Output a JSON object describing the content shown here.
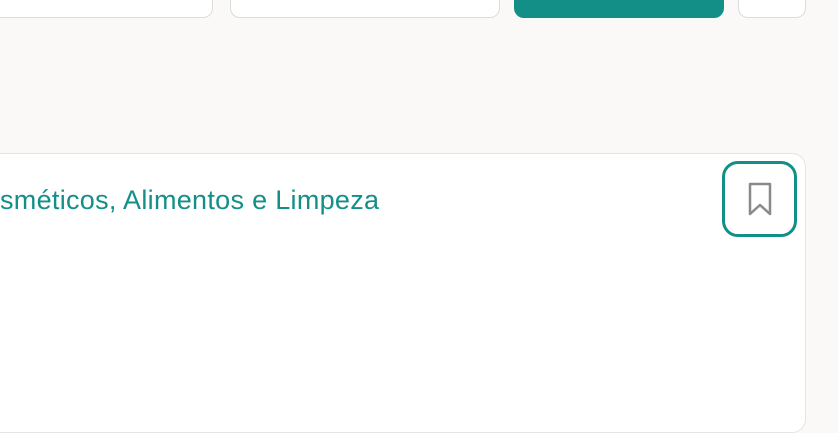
{
  "filters": {
    "buttons": [
      {
        "label": ""
      },
      {
        "label": ""
      },
      {
        "label": "",
        "active": true
      },
      {
        "label": ""
      }
    ]
  },
  "card": {
    "title": "sméticos, Alimentos e Limpeza",
    "bookmark_icon": "bookmark-icon"
  },
  "colors": {
    "accent": "#138f88",
    "background": "#faf9f7",
    "card_border": "#e4e4e4",
    "icon": "#8a8a8a"
  }
}
